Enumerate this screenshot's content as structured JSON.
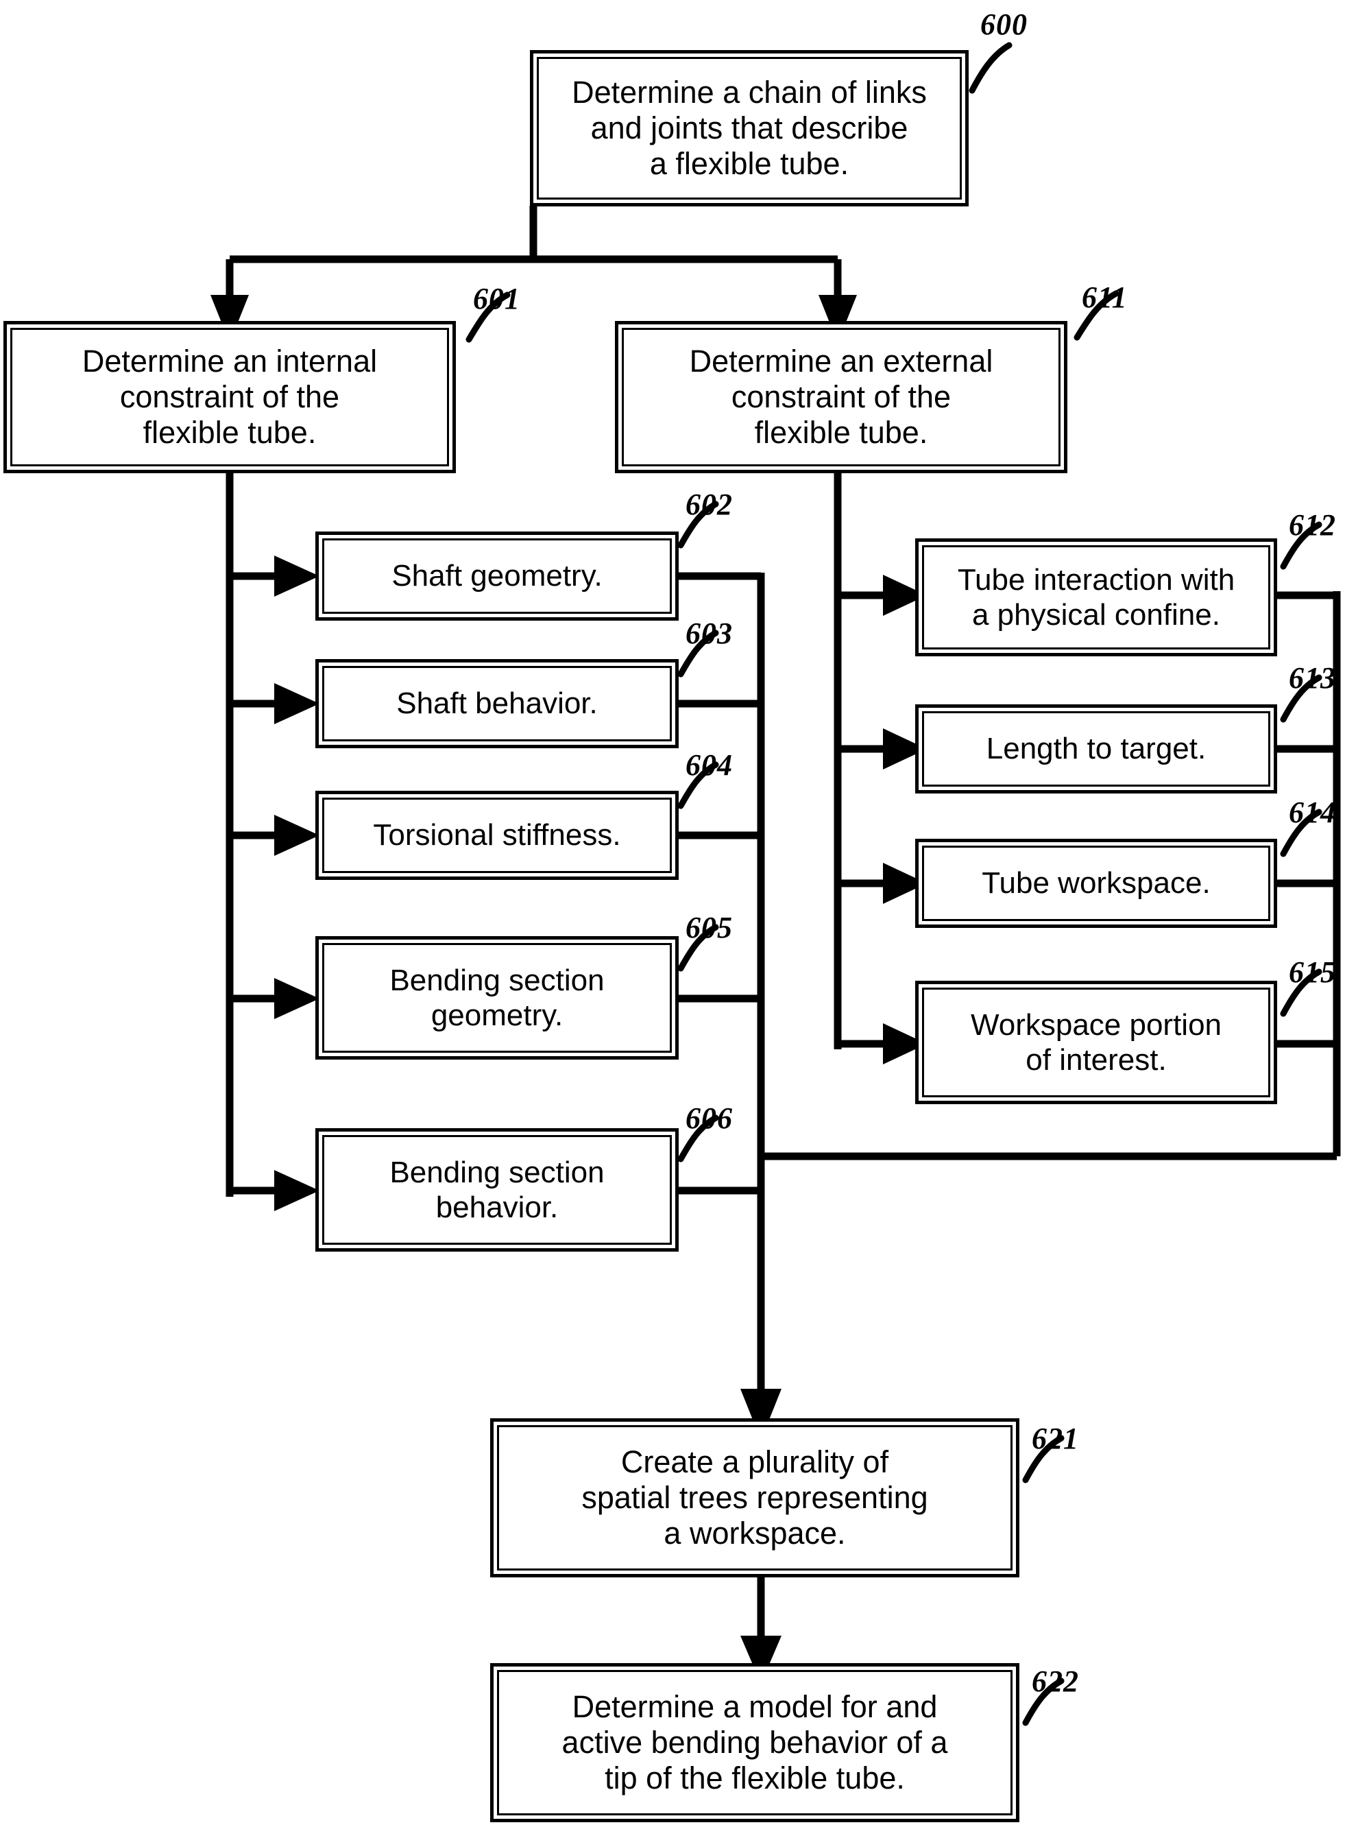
{
  "figure": {
    "type": "patent-flowchart",
    "nodes": [
      {
        "ref": "600",
        "text": "Determine a chain of links\nand joints that describe\na flexible tube."
      },
      {
        "ref": "601",
        "text": "Determine an internal\nconstraint of the\nflexible tube."
      },
      {
        "ref": "611",
        "text": "Determine an external\nconstraint of the\nflexible tube."
      },
      {
        "ref": "602",
        "text": "Shaft geometry."
      },
      {
        "ref": "603",
        "text": "Shaft behavior."
      },
      {
        "ref": "604",
        "text": "Torsional stiffness."
      },
      {
        "ref": "605",
        "text": "Bending section\ngeometry."
      },
      {
        "ref": "606",
        "text": "Bending section\nbehavior."
      },
      {
        "ref": "612",
        "text": "Tube interaction with\na physical confine."
      },
      {
        "ref": "613",
        "text": "Length to target."
      },
      {
        "ref": "614",
        "text": "Tube workspace."
      },
      {
        "ref": "615",
        "text": "Workspace portion\nof interest."
      },
      {
        "ref": "621",
        "text": "Create a plurality of\nspatial trees representing\na workspace."
      },
      {
        "ref": "622",
        "text": "Determine a model for and\nactive bending behavior of a\ntip of the flexible tube."
      }
    ],
    "labels": {
      "n600": "600",
      "n601": "601",
      "n611": "611",
      "n602": "602",
      "n603": "603",
      "n604": "604",
      "n605": "605",
      "n606": "606",
      "n612": "612",
      "n613": "613",
      "n614": "614",
      "n615": "615",
      "n621": "621",
      "n622": "622"
    },
    "texts": {
      "n600": "Determine a chain of links\nand joints that describe\na flexible tube.",
      "n601": "Determine an internal\nconstraint of the\nflexible tube.",
      "n611": "Determine an external\nconstraint of the\nflexible tube.",
      "n602": "Shaft geometry.",
      "n603": "Shaft behavior.",
      "n604": "Torsional stiffness.",
      "n605": "Bending section\ngeometry.",
      "n606": "Bending section\nbehavior.",
      "n612": "Tube interaction with\na physical confine.",
      "n613": "Length to target.",
      "n614": "Tube workspace.",
      "n615": "Workspace portion\nof interest.",
      "n621": "Create a plurality of\nspatial trees representing\na workspace.",
      "n622": "Determine a model for and\nactive bending behavior of a\ntip of the flexible tube."
    },
    "colors": {
      "ink": "#000000",
      "paper": "#ffffff"
    }
  }
}
